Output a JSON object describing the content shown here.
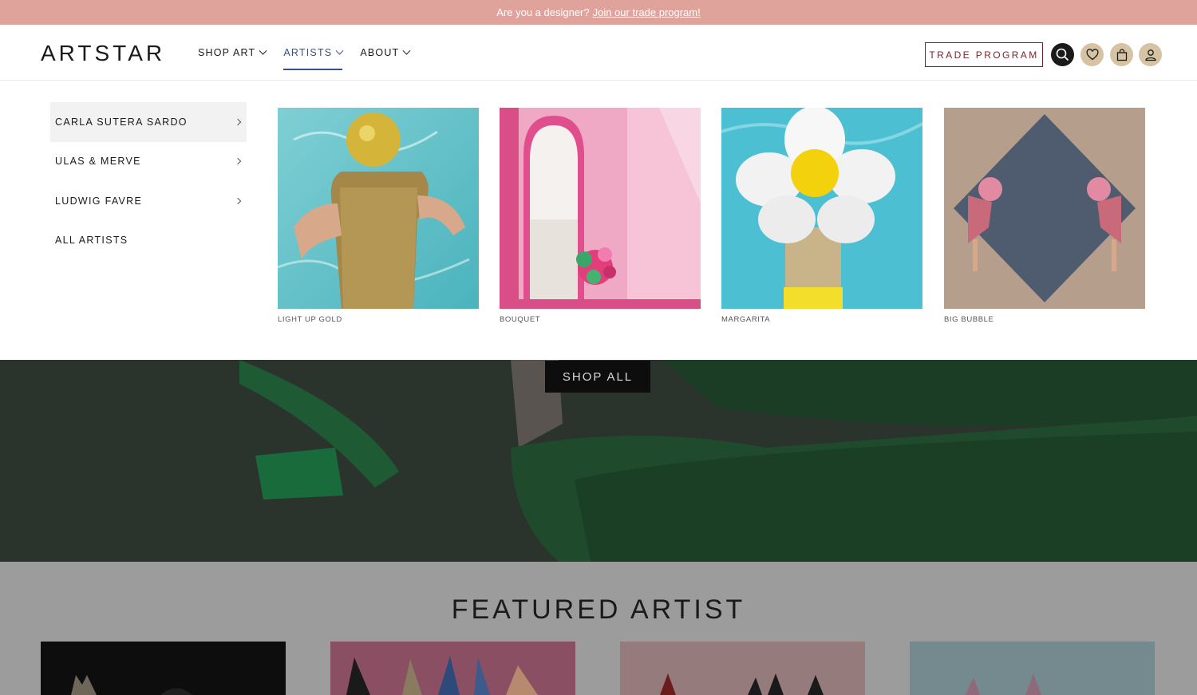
{
  "announcement": {
    "text": "Are you a designer?",
    "link": "Join our trade program!"
  },
  "header": {
    "logo": "ARTSTAR",
    "nav": [
      {
        "label": "SHOP ART"
      },
      {
        "label": "ARTISTS"
      },
      {
        "label": "ABOUT"
      }
    ],
    "trade_button": "TRADE PROGRAM",
    "icons": [
      "search-icon",
      "heart-icon",
      "bag-icon",
      "user-icon"
    ]
  },
  "mega_menu": {
    "artists": [
      {
        "label": "CARLA SUTERA SARDO"
      },
      {
        "label": "ULAS & MERVE"
      },
      {
        "label": "LUDWIG FAVRE"
      },
      {
        "label": "ALL ARTISTS"
      }
    ],
    "artworks": [
      {
        "title": "LIGHT UP GOLD"
      },
      {
        "title": "BOUQUET"
      },
      {
        "title": "MARGARITA"
      },
      {
        "title": "BIG BUBBLE"
      }
    ]
  },
  "hero": {
    "button": "SHOP ALL"
  },
  "featured": {
    "title": "FEATURED ARTIST"
  },
  "colors": {
    "announcement_bg": "#e0a39c",
    "active_nav": "#3a4f87",
    "trade_border": "#7a1f2b",
    "icon_tan": "#d6c3a3"
  }
}
